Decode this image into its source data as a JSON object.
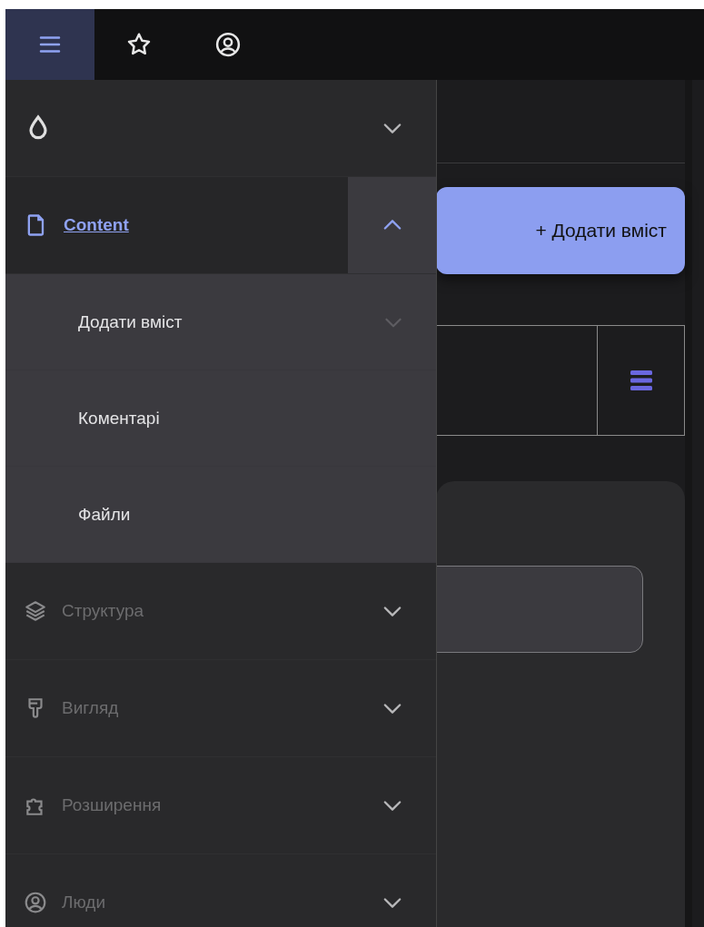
{
  "toolbar": {
    "buttons": [
      {
        "kind": "menu",
        "selected": true
      },
      {
        "kind": "star",
        "selected": false
      },
      {
        "kind": "user",
        "selected": false
      }
    ]
  },
  "content": {
    "add_button": {
      "label": "+ Додати вміст"
    }
  },
  "sidebar": {
    "items": [
      {
        "kind": "drop",
        "expanded": false,
        "disabled": false
      },
      {
        "label": "Content",
        "kind": "file",
        "active": true,
        "expanded": true,
        "disabled": false,
        "children": [
          {
            "label": "Додати вміст",
            "expandable": true
          },
          {
            "label": "Коментарі",
            "expandable": false
          },
          {
            "label": "Файли",
            "expandable": false
          }
        ]
      },
      {
        "label": "Структура",
        "kind": "layers",
        "expanded": false,
        "disabled": true
      },
      {
        "label": "Вигляд",
        "kind": "brush",
        "expanded": false,
        "disabled": true
      },
      {
        "label": "Розширення",
        "kind": "puzzle",
        "expanded": false,
        "disabled": true
      },
      {
        "label": "Люди",
        "kind": "user",
        "expanded": false,
        "disabled": true
      }
    ]
  }
}
